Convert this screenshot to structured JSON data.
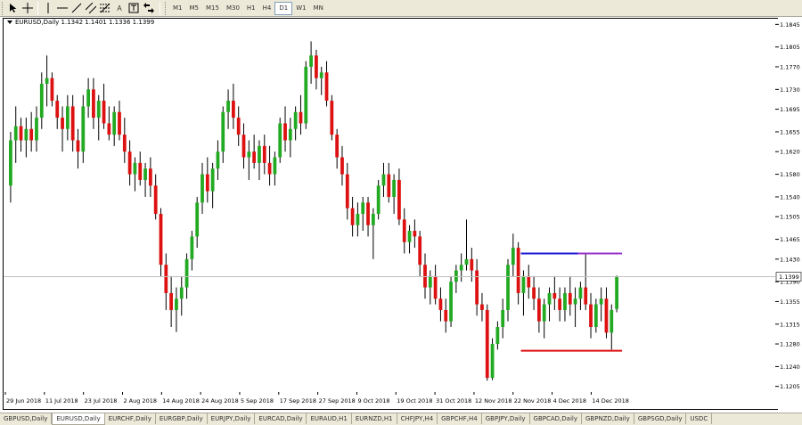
{
  "toolbar": {
    "timeframes": [
      "M1",
      "M5",
      "M15",
      "M30",
      "H1",
      "H4",
      "D1",
      "W1",
      "MN"
    ],
    "active_timeframe": "D1",
    "text_tool_label": "A"
  },
  "chart": {
    "title": "EURUSD,Daily  1.1342 1.1401 1.1336 1.1399",
    "current_price_label": "1.1399",
    "price_labels": [
      "1.1845",
      "1.1805",
      "1.1770",
      "1.1730",
      "1.1695",
      "1.1655",
      "1.1620",
      "1.1580",
      "1.1540",
      "1.1505",
      "1.1465",
      "1.1430",
      "1.1390",
      "1.1355",
      "1.1315",
      "1.1280",
      "1.1240",
      "1.1205"
    ],
    "date_labels": [
      "29 Jun 2018",
      "11 Jul 2018",
      "23 Jul 2018",
      "2 Aug 2018",
      "14 Aug 2018",
      "24 Aug 2018",
      "5 Sep 2018",
      "17 Sep 2018",
      "27 Sep 2018",
      "9 Oct 2018",
      "19 Oct 2018",
      "31 Oct 2018",
      "12 Nov 2018",
      "22 Nov 2018",
      "4 Dec 2018",
      "14 Dec 2018"
    ],
    "colors": {
      "bull": "#22aa22",
      "bear": "#dd1111",
      "wick": "#000000",
      "resistance_blue": "#1a1ad4",
      "resistance_purple": "#9933cc",
      "support": "#dd1111",
      "bid_line": "#c0c0c0"
    }
  },
  "chart_data": {
    "type": "candlestick",
    "symbol": "EURUSD",
    "timeframe": "Daily",
    "last_bar": {
      "open": 1.1342,
      "high": 1.1401,
      "low": 1.1336,
      "close": 1.1399
    },
    "ylim": [
      1.1195,
      1.1855
    ],
    "resistance_level": 1.144,
    "support_level": 1.1268,
    "candles": [
      [
        1.156,
        1.1655,
        1.153,
        1.164
      ],
      [
        1.164,
        1.17,
        1.16,
        1.1665
      ],
      [
        1.1665,
        1.168,
        1.162,
        1.164
      ],
      [
        1.164,
        1.168,
        1.161,
        1.166
      ],
      [
        1.166,
        1.169,
        1.162,
        1.164
      ],
      [
        1.164,
        1.17,
        1.162,
        1.168
      ],
      [
        1.168,
        1.176,
        1.166,
        1.174
      ],
      [
        1.174,
        1.179,
        1.17,
        1.175
      ],
      [
        1.175,
        1.176,
        1.17,
        1.171
      ],
      [
        1.171,
        1.172,
        1.166,
        1.168
      ],
      [
        1.168,
        1.17,
        1.162,
        1.166
      ],
      [
        1.166,
        1.172,
        1.164,
        1.17
      ],
      [
        1.17,
        1.172,
        1.162,
        1.164
      ],
      [
        1.164,
        1.166,
        1.159,
        1.162
      ],
      [
        1.162,
        1.172,
        1.16,
        1.17
      ],
      [
        1.17,
        1.175,
        1.168,
        1.173
      ],
      [
        1.173,
        1.175,
        1.166,
        1.168
      ],
      [
        1.168,
        1.172,
        1.164,
        1.171
      ],
      [
        1.171,
        1.174,
        1.166,
        1.167
      ],
      [
        1.167,
        1.17,
        1.164,
        1.165
      ],
      [
        1.165,
        1.17,
        1.163,
        1.169
      ],
      [
        1.169,
        1.171,
        1.164,
        1.165
      ],
      [
        1.165,
        1.168,
        1.16,
        1.162
      ],
      [
        1.162,
        1.164,
        1.156,
        1.158
      ],
      [
        1.158,
        1.161,
        1.155,
        1.16
      ],
      [
        1.16,
        1.162,
        1.156,
        1.157
      ],
      [
        1.157,
        1.16,
        1.154,
        1.159
      ],
      [
        1.159,
        1.161,
        1.154,
        1.156
      ],
      [
        1.156,
        1.158,
        1.15,
        1.151
      ],
      [
        1.151,
        1.152,
        1.14,
        1.142
      ],
      [
        1.142,
        1.144,
        1.134,
        1.137
      ],
      [
        1.137,
        1.14,
        1.131,
        1.134
      ],
      [
        1.134,
        1.138,
        1.1301,
        1.136
      ],
      [
        1.136,
        1.14,
        1.133,
        1.138
      ],
      [
        1.138,
        1.144,
        1.136,
        1.143
      ],
      [
        1.143,
        1.148,
        1.141,
        1.147
      ],
      [
        1.147,
        1.154,
        1.145,
        1.153
      ],
      [
        1.153,
        1.16,
        1.151,
        1.158
      ],
      [
        1.158,
        1.161,
        1.153,
        1.155
      ],
      [
        1.155,
        1.16,
        1.152,
        1.159
      ],
      [
        1.159,
        1.164,
        1.157,
        1.162
      ],
      [
        1.162,
        1.17,
        1.16,
        1.169
      ],
      [
        1.169,
        1.173,
        1.166,
        1.171
      ],
      [
        1.171,
        1.174,
        1.166,
        1.168
      ],
      [
        1.168,
        1.17,
        1.163,
        1.165
      ],
      [
        1.165,
        1.167,
        1.159,
        1.161
      ],
      [
        1.161,
        1.164,
        1.157,
        1.162
      ],
      [
        1.162,
        1.165,
        1.159,
        1.16
      ],
      [
        1.16,
        1.164,
        1.157,
        1.163
      ],
      [
        1.163,
        1.165,
        1.158,
        1.16
      ],
      [
        1.16,
        1.163,
        1.156,
        1.158
      ],
      [
        1.158,
        1.162,
        1.156,
        1.161
      ],
      [
        1.161,
        1.168,
        1.16,
        1.167
      ],
      [
        1.167,
        1.17,
        1.162,
        1.164
      ],
      [
        1.164,
        1.168,
        1.161,
        1.166
      ],
      [
        1.166,
        1.17,
        1.164,
        1.169
      ],
      [
        1.169,
        1.172,
        1.165,
        1.167
      ],
      [
        1.167,
        1.178,
        1.166,
        1.177
      ],
      [
        1.177,
        1.1815,
        1.174,
        1.179
      ],
      [
        1.179,
        1.18,
        1.173,
        1.175
      ],
      [
        1.175,
        1.177,
        1.172,
        1.176
      ],
      [
        1.176,
        1.178,
        1.17,
        1.171
      ],
      [
        1.171,
        1.172,
        1.164,
        1.165
      ],
      [
        1.165,
        1.166,
        1.159,
        1.161
      ],
      [
        1.161,
        1.163,
        1.156,
        1.158
      ],
      [
        1.158,
        1.16,
        1.15,
        1.152
      ],
      [
        1.152,
        1.154,
        1.147,
        1.149
      ],
      [
        1.149,
        1.153,
        1.147,
        1.151
      ],
      [
        1.151,
        1.154,
        1.148,
        1.153
      ],
      [
        1.153,
        1.154,
        1.147,
        1.149
      ],
      [
        1.149,
        1.152,
        1.143,
        1.151
      ],
      [
        1.151,
        1.157,
        1.15,
        1.156
      ],
      [
        1.156,
        1.16,
        1.154,
        1.158
      ],
      [
        1.158,
        1.16,
        1.153,
        1.154
      ],
      [
        1.154,
        1.158,
        1.151,
        1.157
      ],
      [
        1.157,
        1.159,
        1.149,
        1.15
      ],
      [
        1.15,
        1.152,
        1.144,
        1.146
      ],
      [
        1.146,
        1.149,
        1.144,
        1.148
      ],
      [
        1.148,
        1.15,
        1.145,
        1.147
      ],
      [
        1.147,
        1.148,
        1.14,
        1.142
      ],
      [
        1.142,
        1.144,
        1.136,
        1.138
      ],
      [
        1.138,
        1.141,
        1.135,
        1.14
      ],
      [
        1.14,
        1.142,
        1.135,
        1.136
      ],
      [
        1.136,
        1.138,
        1.132,
        1.134
      ],
      [
        1.134,
        1.136,
        1.13,
        1.132
      ],
      [
        1.132,
        1.14,
        1.131,
        1.139
      ],
      [
        1.139,
        1.142,
        1.137,
        1.141
      ],
      [
        1.141,
        1.144,
        1.139,
        1.142
      ],
      [
        1.142,
        1.15,
        1.141,
        1.143
      ],
      [
        1.143,
        1.145,
        1.139,
        1.141
      ],
      [
        1.141,
        1.143,
        1.133,
        1.135
      ],
      [
        1.135,
        1.137,
        1.132,
        1.134
      ],
      [
        1.134,
        1.135,
        1.1215,
        1.122
      ],
      [
        1.122,
        1.129,
        1.1216,
        1.128
      ],
      [
        1.128,
        1.132,
        1.127,
        1.131
      ],
      [
        1.131,
        1.136,
        1.129,
        1.134
      ],
      [
        1.134,
        1.143,
        1.132,
        1.142
      ],
      [
        1.142,
        1.1475,
        1.14,
        1.145
      ],
      [
        1.145,
        1.146,
        1.135,
        1.137
      ],
      [
        1.137,
        1.141,
        1.133,
        1.14
      ],
      [
        1.14,
        1.142,
        1.136,
        1.138
      ],
      [
        1.138,
        1.14,
        1.134,
        1.136
      ],
      [
        1.136,
        1.138,
        1.13,
        1.132
      ],
      [
        1.132,
        1.136,
        1.129,
        1.135
      ],
      [
        1.135,
        1.138,
        1.132,
        1.137
      ],
      [
        1.137,
        1.14,
        1.134,
        1.136
      ],
      [
        1.136,
        1.138,
        1.132,
        1.134
      ],
      [
        1.134,
        1.138,
        1.132,
        1.137
      ],
      [
        1.137,
        1.14,
        1.133,
        1.135
      ],
      [
        1.135,
        1.138,
        1.131,
        1.136
      ],
      [
        1.136,
        1.139,
        1.134,
        1.138
      ],
      [
        1.138,
        1.144,
        1.134,
        1.135
      ],
      [
        1.135,
        1.137,
        1.129,
        1.131
      ],
      [
        1.131,
        1.136,
        1.13,
        1.135
      ],
      [
        1.135,
        1.138,
        1.132,
        1.136
      ],
      [
        1.136,
        1.138,
        1.129,
        1.13
      ],
      [
        1.13,
        1.135,
        1.127,
        1.134
      ],
      [
        1.1342,
        1.1401,
        1.1336,
        1.1399
      ]
    ]
  },
  "tabs": [
    "GBPUSD,Daily",
    "EURUSD,Daily",
    "EURCHF,Daily",
    "EURGBP,Daily",
    "EURJPY,Daily",
    "EURCAD,Daily",
    "EURAUD,H1",
    "EURNZD,H1",
    "CHFJPY,H4",
    "GBPCHF,H4",
    "GBPJPY,Daily",
    "GBPCAD,Daily",
    "GBPNZD,Daily",
    "GBPSGD,Daily",
    "USDC"
  ],
  "active_tab": "EURUSD,Daily"
}
